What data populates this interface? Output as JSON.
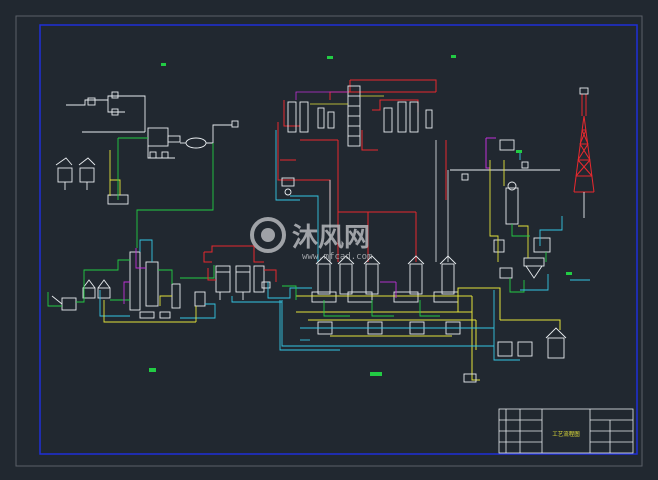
{
  "watermark": {
    "brand": "沐风网",
    "url": "www.mfcad.com"
  },
  "title_block": {
    "drawing_title_line1": "",
    "drawing_title_line2": "工艺流程图"
  },
  "colors": {
    "background": "#212830",
    "frame": "#1f2fd8",
    "line_white": "#e8ecef",
    "line_red": "#e8282e",
    "line_yellow": "#e4e23a",
    "line_green": "#22cc44",
    "line_cyan": "#34c6e4",
    "line_magenta": "#c030d8",
    "watermark": "#b5b8bc"
  },
  "icons": [
    "tower-icon",
    "fan-blower-icon",
    "reactor-vessel-icon",
    "tank-icon",
    "filter-icon"
  ]
}
